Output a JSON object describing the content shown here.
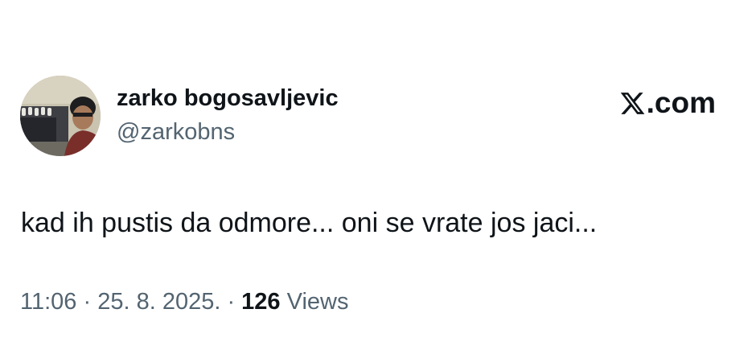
{
  "author": {
    "display_name": "zarko bogosavljevic",
    "handle": "@zarkobns",
    "avatar_icon": "profile-photo"
  },
  "brand": {
    "label": ".com",
    "logo_icon": "x-logo-icon"
  },
  "tweet": {
    "text": "kad ih pustis da odmore... oni se vrate jos jaci..."
  },
  "meta": {
    "time": "11:06",
    "separator_1": " · ",
    "date": "25. 8. 2025.",
    "separator_2": " · ",
    "views_count": "126",
    "views_label": " Views"
  },
  "colors": {
    "text_primary": "#0f1419",
    "text_secondary": "#536471",
    "background": "#ffffff"
  }
}
